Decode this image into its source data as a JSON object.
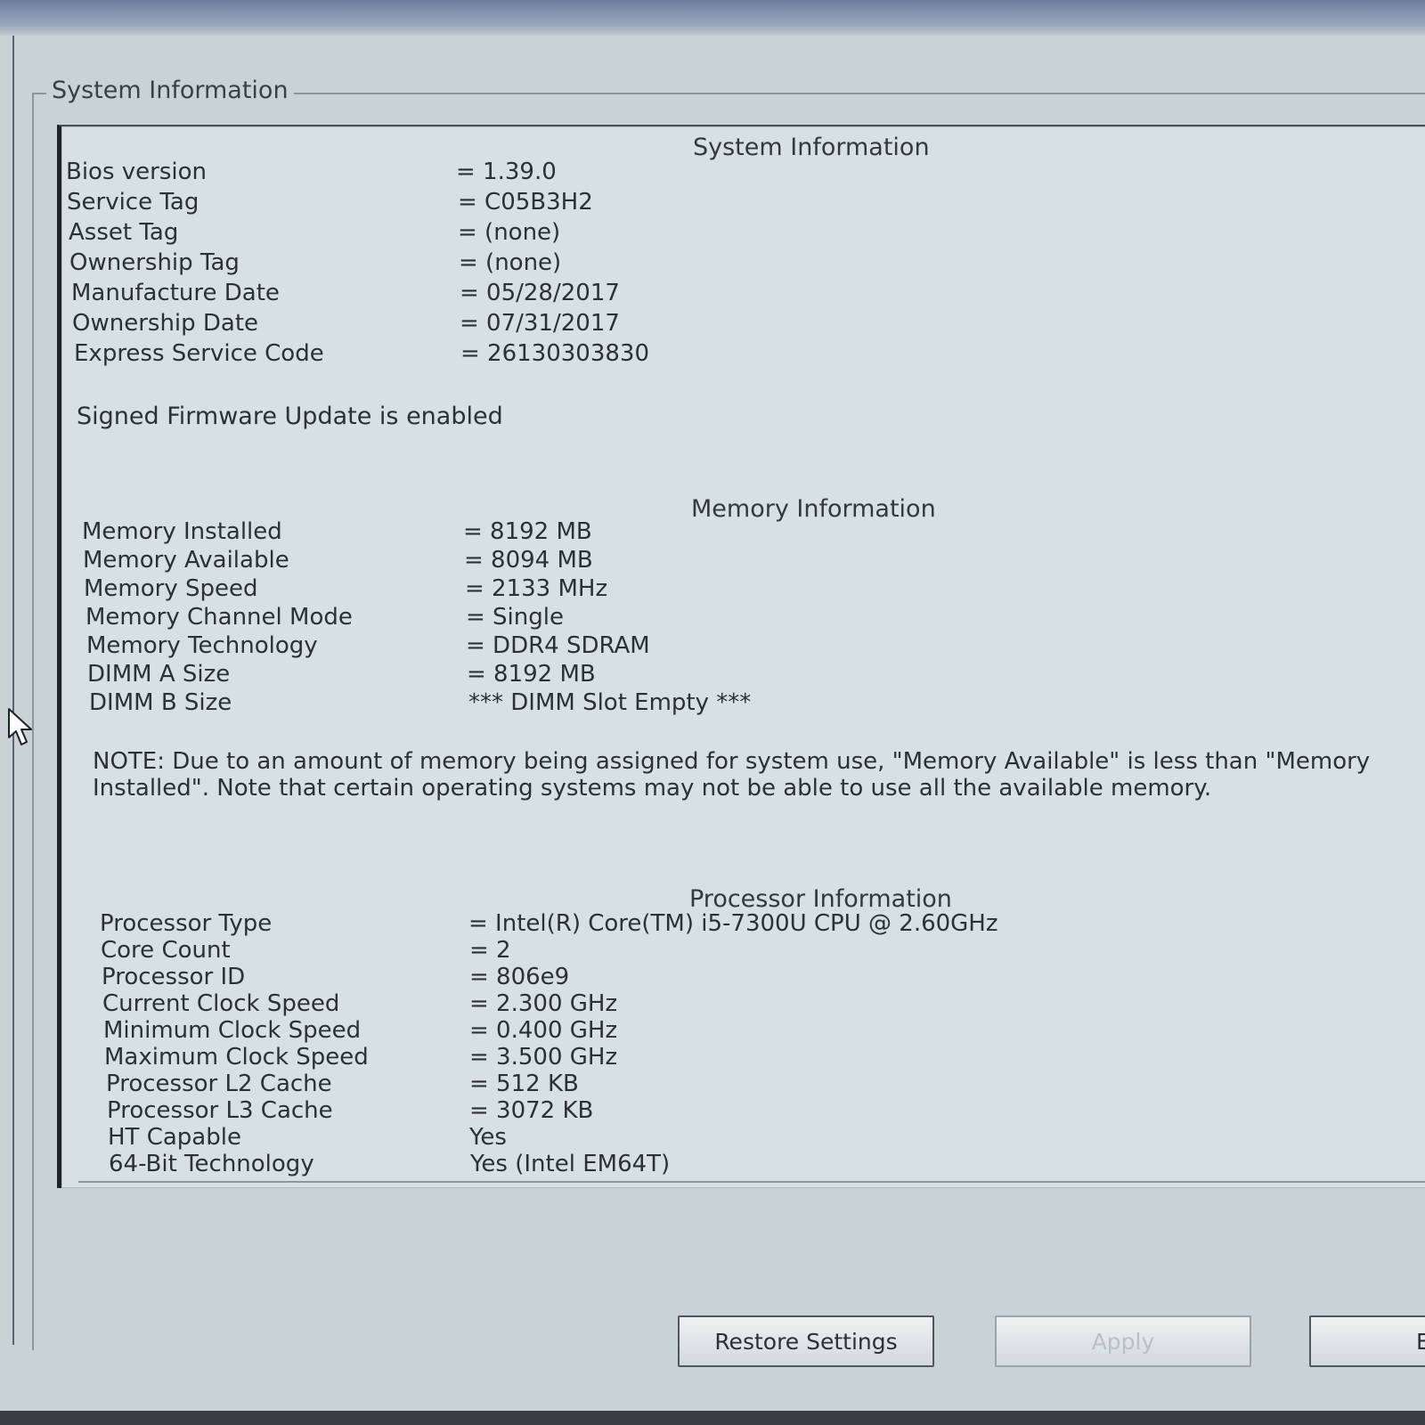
{
  "group_title": "System Information",
  "system": {
    "title": "System Information",
    "rows": [
      {
        "label": "Bios version",
        "value": "= 1.39.0"
      },
      {
        "label": "Service Tag",
        "value": "= C05B3H2"
      },
      {
        "label": "Asset Tag",
        "value": "= (none)"
      },
      {
        "label": "Ownership Tag",
        "value": "= (none)"
      },
      {
        "label": "Manufacture Date",
        "value": "= 05/28/2017"
      },
      {
        "label": "Ownership Date",
        "value": "= 07/31/2017"
      },
      {
        "label": "Express Service Code",
        "value": "= 26130303830"
      }
    ],
    "signed_firmware": "Signed Firmware Update is enabled"
  },
  "memory": {
    "title": "Memory Information",
    "rows": [
      {
        "label": "Memory Installed",
        "value": "= 8192 MB"
      },
      {
        "label": "Memory Available",
        "value": "= 8094 MB"
      },
      {
        "label": "Memory Speed",
        "value": "= 2133 MHz"
      },
      {
        "label": "Memory Channel Mode",
        "value": "= Single"
      },
      {
        "label": "Memory Technology",
        "value": "= DDR4 SDRAM"
      },
      {
        "label": "DIMM A Size",
        "value": "= 8192 MB"
      },
      {
        "label": "DIMM B Size",
        "value": "*** DIMM Slot Empty ***"
      }
    ],
    "note": "NOTE: Due to an amount of memory being assigned for system use, \"Memory Available\" is less than \"Memory Installed\". Note that certain operating systems may not be able to use all the available memory."
  },
  "processor": {
    "title": "Processor Information",
    "rows": [
      {
        "label": "Processor Type",
        "value": "= Intel(R) Core(TM) i5-7300U CPU @ 2.60GHz"
      },
      {
        "label": "Core Count",
        "value": "= 2"
      },
      {
        "label": "Processor ID",
        "value": "= 806e9"
      },
      {
        "label": "Current Clock Speed",
        "value": "= 2.300 GHz"
      },
      {
        "label": "Minimum Clock Speed",
        "value": "= 0.400 GHz"
      },
      {
        "label": "Maximum Clock Speed",
        "value": "= 3.500 GHz"
      },
      {
        "label": "Processor L2 Cache",
        "value": "= 512 KB"
      },
      {
        "label": "Processor L3 Cache",
        "value": "= 3072 KB"
      },
      {
        "label": "HT Capable",
        "value": "Yes"
      },
      {
        "label": "64-Bit Technology",
        "value": "Yes (Intel EM64T)"
      }
    ]
  },
  "buttons": {
    "restore": "Restore Settings",
    "apply": "Apply",
    "exit_partial": "E"
  }
}
